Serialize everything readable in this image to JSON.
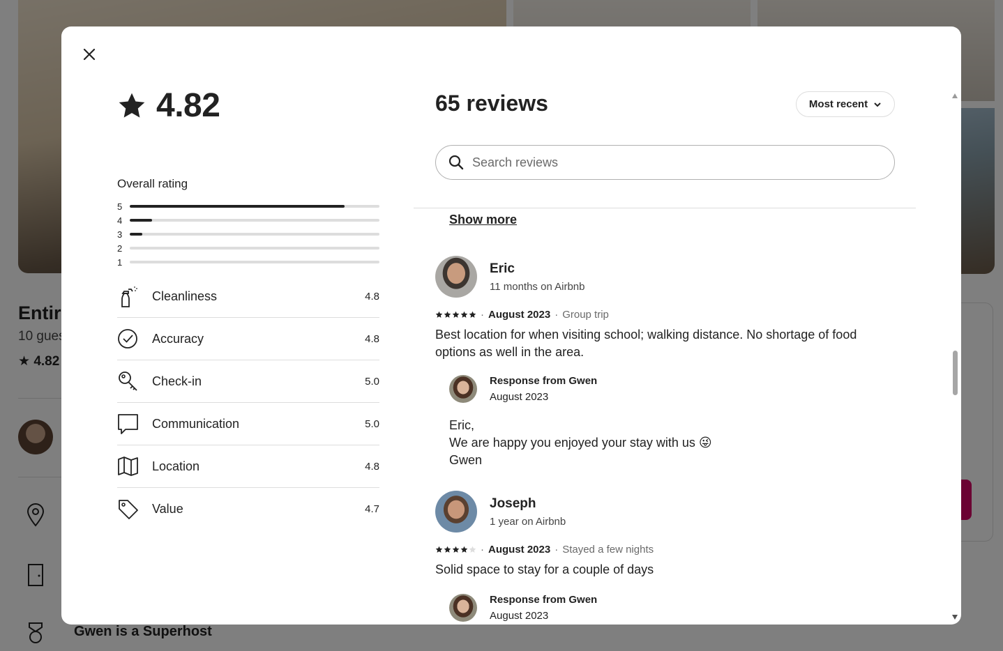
{
  "background": {
    "title": "Entire",
    "subtitle": "10 gues",
    "rating": "4.82",
    "superhost": "Gwen is a Superhost"
  },
  "summary": {
    "overall_score": "4.82",
    "overall_label": "Overall rating",
    "histogram": [
      {
        "label": "5",
        "fraction": 0.86
      },
      {
        "label": "4",
        "fraction": 0.09
      },
      {
        "label": "3",
        "fraction": 0.05
      },
      {
        "label": "2",
        "fraction": 0.0
      },
      {
        "label": "1",
        "fraction": 0.0
      }
    ],
    "categories": [
      {
        "icon": "spray-bottle-icon",
        "name": "Cleanliness",
        "score": "4.8"
      },
      {
        "icon": "check-circle-icon",
        "name": "Accuracy",
        "score": "4.8"
      },
      {
        "icon": "key-icon",
        "name": "Check-in",
        "score": "5.0"
      },
      {
        "icon": "chat-bubble-icon",
        "name": "Communication",
        "score": "5.0"
      },
      {
        "icon": "map-icon",
        "name": "Location",
        "score": "4.8"
      },
      {
        "icon": "tag-icon",
        "name": "Value",
        "score": "4.7"
      }
    ]
  },
  "reviews_panel": {
    "count_label": "65 reviews",
    "sort_label": "Most recent",
    "search_placeholder": "Search reviews",
    "show_more": "Show more",
    "reviews": [
      {
        "name": "Eric",
        "tenure": "11 months on Airbnb",
        "stars": 5,
        "date": "August 2023",
        "trip": "Group trip",
        "text": "Best location for when visiting school; walking distance. No shortage of food options as well in the area.",
        "response": {
          "from": "Response from Gwen",
          "date": "August 2023",
          "lines": [
            "Eric,",
            "We are happy you enjoyed your stay with us 😜",
            "Gwen"
          ]
        }
      },
      {
        "name": "Joseph",
        "tenure": "1 year on Airbnb",
        "stars": 4,
        "date": "August 2023",
        "trip": "Stayed a few nights",
        "text": "Solid space to stay for a couple of days",
        "response": {
          "from": "Response from Gwen",
          "date": "August 2023"
        }
      }
    ]
  },
  "colors": {
    "text": "#222222",
    "muted": "#6a6a6a",
    "divider": "#dddddd",
    "brand": "#d70466"
  }
}
